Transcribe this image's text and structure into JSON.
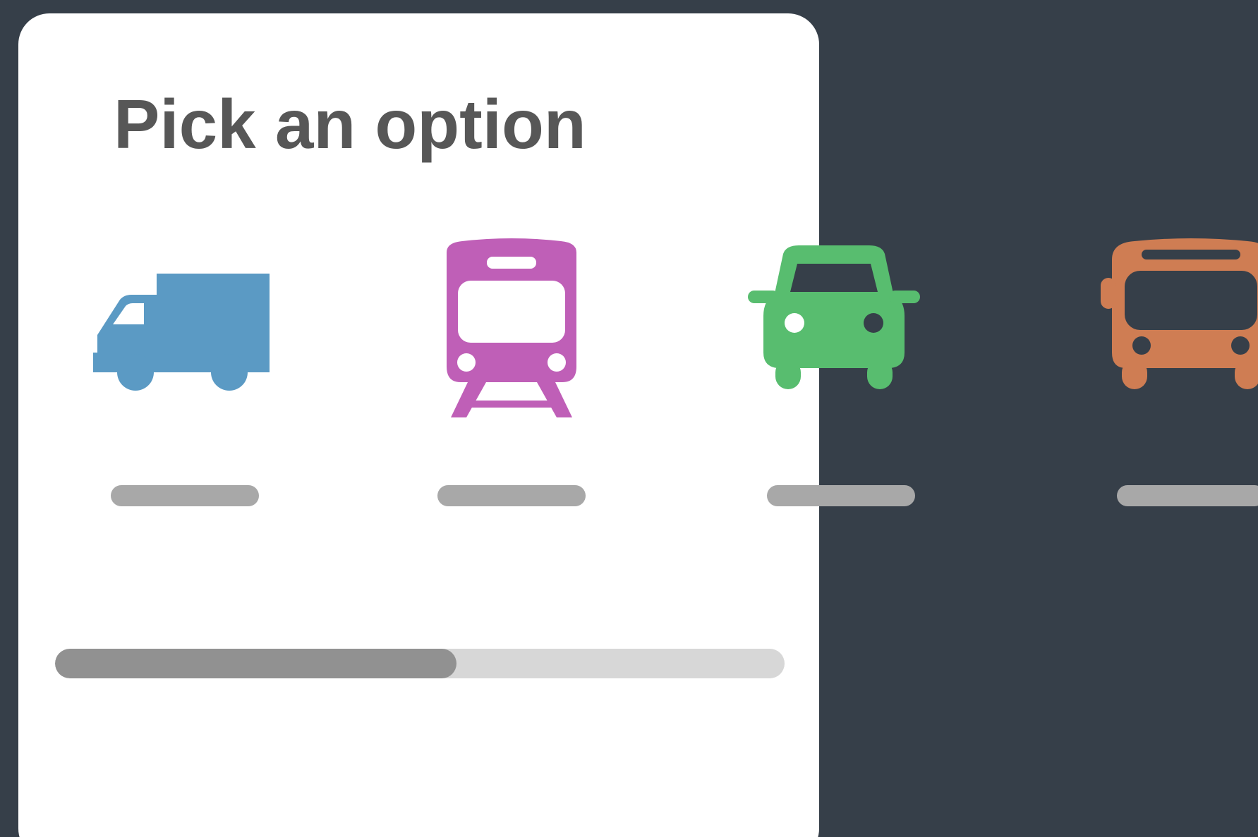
{
  "title": "Pick an option",
  "colors": {
    "background": "#363f49",
    "card": "#ffffff",
    "title": "#575757",
    "label_placeholder": "#a8a8a8",
    "progress_track": "#d7d7d7",
    "progress_fill": "#919191"
  },
  "options": [
    {
      "icon": "truck-icon",
      "color": "#5b9ac4"
    },
    {
      "icon": "train-icon",
      "color": "#bf5fb7"
    },
    {
      "icon": "car-icon",
      "color": "#58bd6f"
    },
    {
      "icon": "bus-icon",
      "color": "#cf7d53"
    }
  ],
  "progress": {
    "fraction": 0.55
  }
}
